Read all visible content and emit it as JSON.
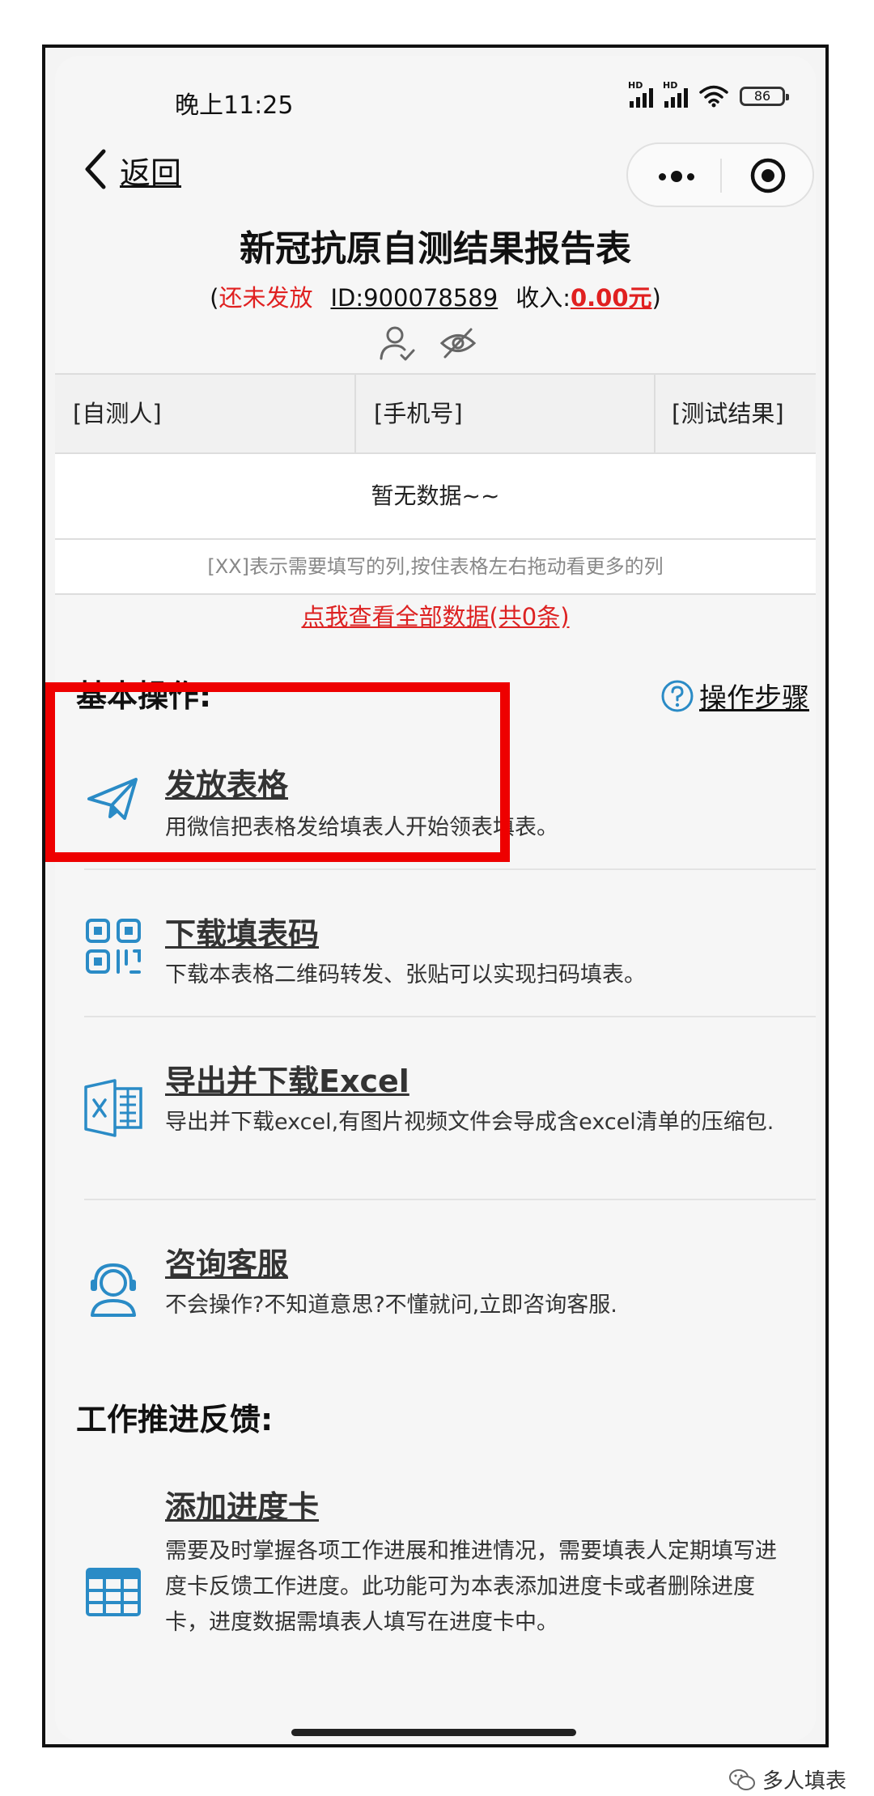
{
  "status_bar": {
    "time": "晚上11:25",
    "battery": "86",
    "signal_label": "HD"
  },
  "nav": {
    "back_label": "返回"
  },
  "page": {
    "title": "新冠抗原自测结果报告表",
    "open_paren": "(",
    "status": "还未发放",
    "id_text": "ID:900078589",
    "income_label": "收入:",
    "income_value": "0.00元",
    "close_paren": ")"
  },
  "table": {
    "headers": [
      "[自测人]",
      "[手机号]",
      "[测试结果]"
    ],
    "empty_text": "暂无数据~~",
    "hint": "[XX]表示需要填写的列,按住表格左右拖动看更多的列"
  },
  "view_all_link": "点我查看全部数据(共0条)",
  "basic_ops": {
    "title": "基本操作:",
    "help_label": "操作步骤",
    "items": [
      {
        "title": "发放表格",
        "desc": "用微信把表格发给填表人开始领表填表。",
        "icon": "paper-plane-icon"
      },
      {
        "title": "下载填表码",
        "desc": "下载本表格二维码转发、张贴可以实现扫码填表。",
        "icon": "qr-code-icon"
      },
      {
        "title": "导出并下载Excel",
        "desc": "导出并下载excel,有图片视频文件会导成含excel清单的压缩包.",
        "icon": "excel-icon"
      },
      {
        "title": "咨询客服",
        "desc": "不会操作?不知道意思?不懂就问,立即咨询客服.",
        "icon": "customer-service-icon"
      }
    ]
  },
  "feedback": {
    "title": "工作推进反馈:",
    "item_title": "添加进度卡",
    "item_desc": "需要及时掌握各项工作进展和推进情况，需要填表人定期填写进度卡反馈工作进度。此功能可为本表添加进度卡或者删除进度卡，进度数据需填表人填写在进度卡中。",
    "icon": "table-grid-icon"
  },
  "watermark": "多人填表",
  "colors": {
    "accent_blue": "#2a8bc6",
    "alert_red": "#e02020",
    "highlight_red": "#ee0000"
  }
}
